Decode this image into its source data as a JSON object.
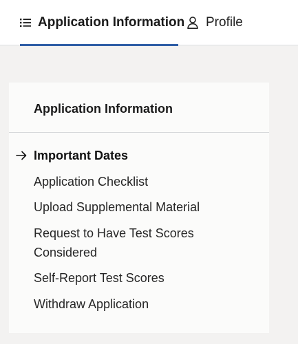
{
  "tabs": [
    {
      "label": "Application Information",
      "icon": "list-icon",
      "active": true
    },
    {
      "label": "Profile",
      "icon": "person-icon",
      "active": false
    }
  ],
  "sidebar": {
    "title": "Application Information",
    "items": [
      {
        "label": "Important Dates",
        "current": true
      },
      {
        "label": "Application Checklist"
      },
      {
        "label": "Upload Supplemental Material"
      },
      {
        "label": "Request to Have Test Scores Considered"
      },
      {
        "label": "Self-Report Test Scores"
      },
      {
        "label": "Withdraw Application"
      }
    ]
  },
  "colors": {
    "accent": "#2f5ea6",
    "page_background": "#f3f2f1",
    "card_background": "#fbfbfa"
  }
}
